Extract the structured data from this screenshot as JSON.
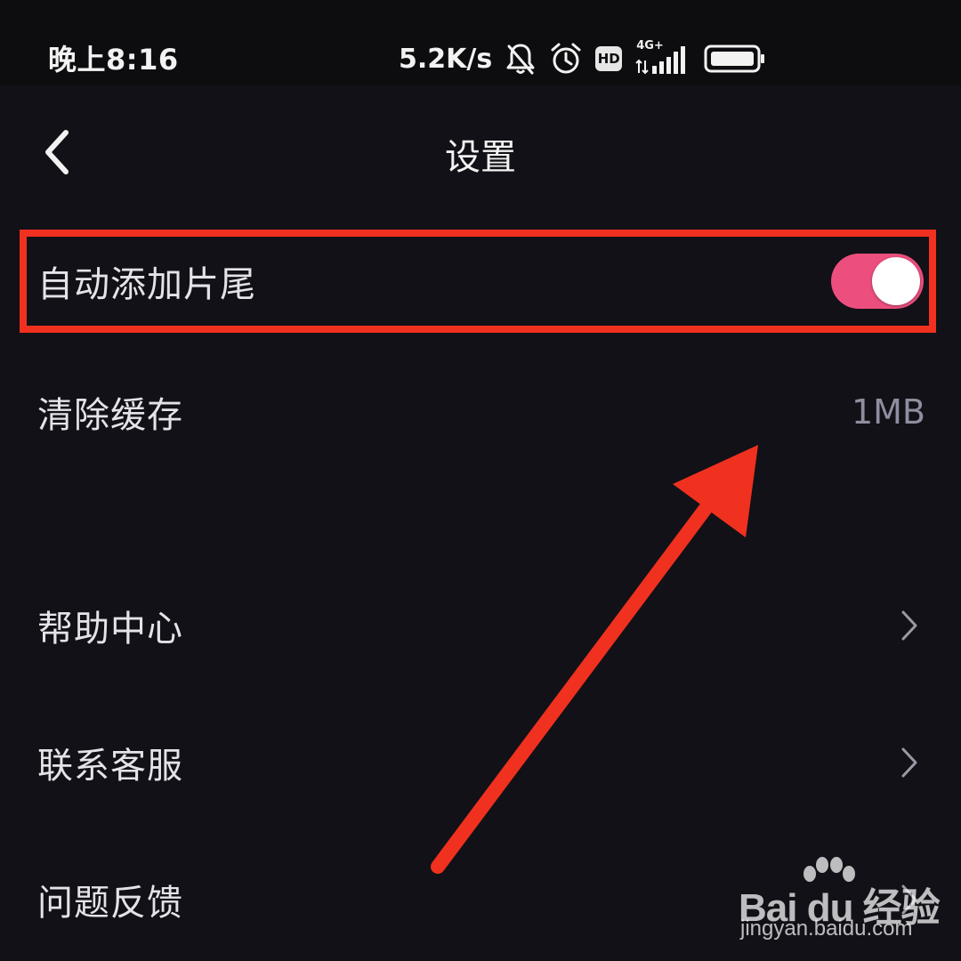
{
  "status_bar": {
    "time": "晚上8:16",
    "net_speed": "5.2K/s",
    "hd_label": "HD",
    "network_label": "4G+",
    "icons": [
      "mute-bell-icon",
      "alarm-clock-icon",
      "hd-icon",
      "signal-icon",
      "battery-icon"
    ]
  },
  "header": {
    "title": "设置",
    "back_icon": "chevron-left-icon"
  },
  "settings": {
    "auto_tail": {
      "label": "自动添加片尾",
      "enabled": true
    },
    "clear_cache": {
      "label": "清除缓存",
      "value": "1MB"
    },
    "help_center": {
      "label": "帮助中心"
    },
    "contact_support": {
      "label": "联系客服"
    },
    "feedback": {
      "label": "问题反馈"
    }
  },
  "watermark": {
    "brand": "Bai du 经验",
    "url": "jingyan.baidu.com"
  },
  "colors": {
    "background": "#121117",
    "toggle_on": "#ec4f7e",
    "annotation": "#f0311f",
    "muted_value": "#8e8ea0"
  }
}
